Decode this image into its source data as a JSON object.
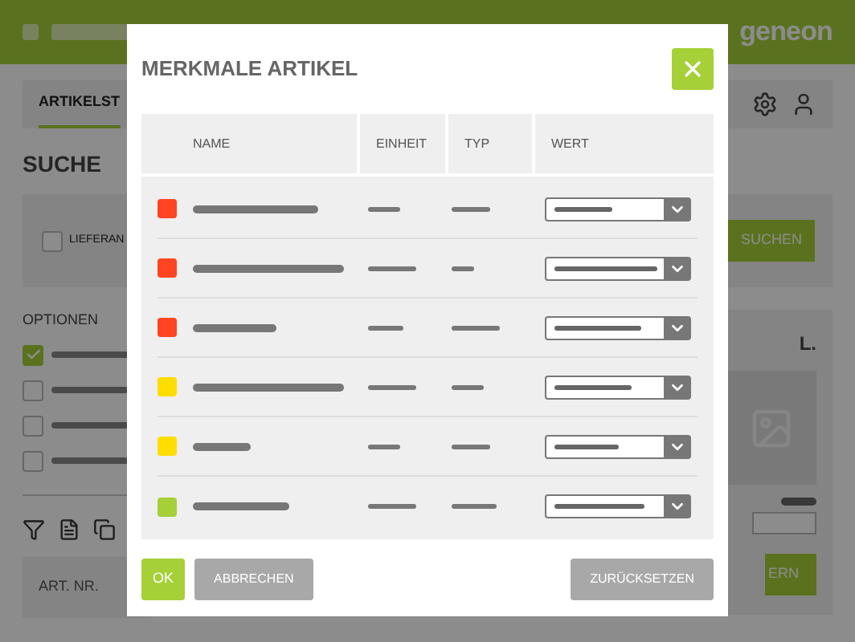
{
  "header": {
    "logo": "geneon"
  },
  "nav": {
    "tab": "ARTIKELST",
    "selected": true
  },
  "page_title": "SUCHE",
  "search": {
    "checkbox_label": "LIEFERAN",
    "checked": false,
    "button": "SUCHEN"
  },
  "options": {
    "title": "OPTIONEN",
    "items": [
      {
        "checked": true
      },
      {
        "checked": false
      },
      {
        "checked": false
      },
      {
        "checked": false
      }
    ]
  },
  "results": {
    "column": "ART. NR."
  },
  "side_card": {
    "title": "L.",
    "button": "ERN"
  },
  "dialog": {
    "title": "MERKMALE ARTIKEL",
    "columns": [
      "NAME",
      "EINHEIT",
      "TYP",
      "WERT"
    ],
    "rows": [
      {
        "color": "#ff4422"
      },
      {
        "color": "#ff4422"
      },
      {
        "color": "#ff4422"
      },
      {
        "color": "#ffdd00"
      },
      {
        "color": "#ffdd00"
      },
      {
        "color": "#a5d037"
      }
    ],
    "buttons": {
      "ok": "OK",
      "cancel": "ABBRECHEN",
      "reset": "ZURÜCKSETZEN"
    }
  }
}
